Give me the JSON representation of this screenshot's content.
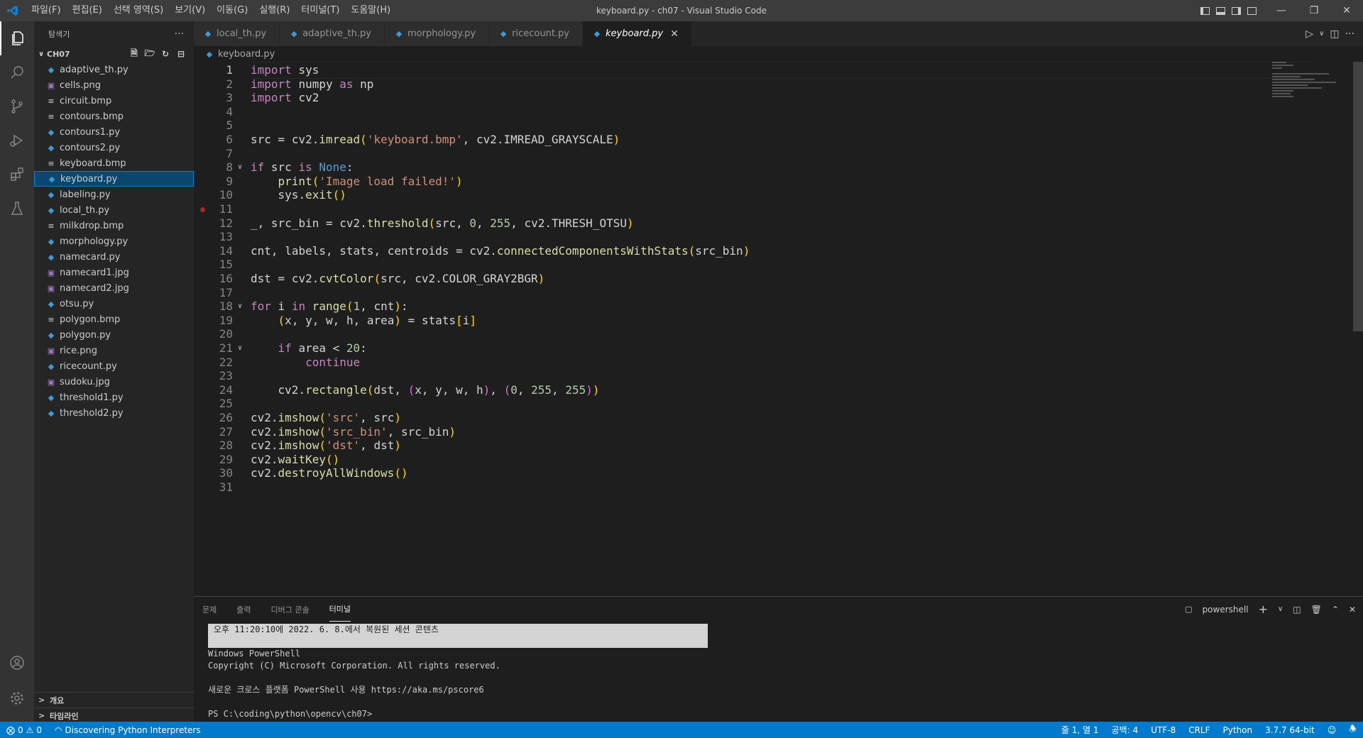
{
  "window": {
    "title": "keyboard.py - ch07 - Visual Studio Code",
    "menu": [
      "파일(F)",
      "편집(E)",
      "선택 영역(S)",
      "보기(V)",
      "이동(G)",
      "실행(R)",
      "터미널(T)",
      "도움말(H)"
    ]
  },
  "colors": {
    "accent": "#007acc",
    "selection": "#094771",
    "keyword": "#c586c0",
    "string": "#ce9178",
    "number": "#b5cea8",
    "function": "#dcdcaa"
  },
  "sidebar": {
    "header": "탐색기",
    "folder": "CH07",
    "files": [
      {
        "name": "adaptive_th.py",
        "type": "py"
      },
      {
        "name": "cells.png",
        "type": "img"
      },
      {
        "name": "circuit.bmp",
        "type": "bmp"
      },
      {
        "name": "contours.bmp",
        "type": "bmp"
      },
      {
        "name": "contours1.py",
        "type": "py"
      },
      {
        "name": "contours2.py",
        "type": "py"
      },
      {
        "name": "keyboard.bmp",
        "type": "bmp"
      },
      {
        "name": "keyboard.py",
        "type": "py",
        "selected": true
      },
      {
        "name": "labeling.py",
        "type": "py"
      },
      {
        "name": "local_th.py",
        "type": "py"
      },
      {
        "name": "milkdrop.bmp",
        "type": "bmp"
      },
      {
        "name": "morphology.py",
        "type": "py"
      },
      {
        "name": "namecard.py",
        "type": "py"
      },
      {
        "name": "namecard1.jpg",
        "type": "img"
      },
      {
        "name": "namecard2.jpg",
        "type": "img"
      },
      {
        "name": "otsu.py",
        "type": "py"
      },
      {
        "name": "polygon.bmp",
        "type": "bmp"
      },
      {
        "name": "polygon.py",
        "type": "py"
      },
      {
        "name": "rice.png",
        "type": "img"
      },
      {
        "name": "ricecount.py",
        "type": "py"
      },
      {
        "name": "sudoku.jpg",
        "type": "img"
      },
      {
        "name": "threshold1.py",
        "type": "py"
      },
      {
        "name": "threshold2.py",
        "type": "py"
      }
    ],
    "outline": "개요",
    "timeline": "타임라인"
  },
  "tabs": [
    {
      "label": "local_th.py",
      "active": false
    },
    {
      "label": "adaptive_th.py",
      "active": false
    },
    {
      "label": "morphology.py",
      "active": false
    },
    {
      "label": "ricecount.py",
      "active": false
    },
    {
      "label": "keyboard.py",
      "active": true
    }
  ],
  "breadcrumb": "keyboard.py",
  "code_lines": [
    "import sys",
    "import numpy as np",
    "import cv2",
    "",
    "",
    "src = cv2.imread('keyboard.bmp', cv2.IMREAD_GRAYSCALE)",
    "",
    "if src is None:",
    "    print('Image load failed!')",
    "    sys.exit()",
    "",
    "_, src_bin = cv2.threshold(src, 0, 255, cv2.THRESH_OTSU)",
    "",
    "cnt, labels, stats, centroids = cv2.connectedComponentsWithStats(src_bin)",
    "",
    "dst = cv2.cvtColor(src, cv2.COLOR_GRAY2BGR)",
    "",
    "for i in range(1, cnt):",
    "    (x, y, w, h, area) = stats[i]",
    "",
    "    if area < 20:",
    "        continue",
    "",
    "    cv2.rectangle(dst, (x, y, w, h), (0, 255, 255))",
    "",
    "cv2.imshow('src', src)",
    "cv2.imshow('src_bin', src_bin)",
    "cv2.imshow('dst', dst)",
    "cv2.waitKey()",
    "cv2.destroyAllWindows()",
    ""
  ],
  "panel": {
    "tabs": [
      "문제",
      "출력",
      "디버그 콘솔",
      "터미널"
    ],
    "active_tab": "터미널",
    "shell": "powershell",
    "terminal": {
      "banner": "오후 11:20:10에 2022. 6. 8.에서 복원된 세션 콘텐츠",
      "lines": [
        "Windows PowerShell",
        "Copyright (C) Microsoft Corporation. All rights reserved.",
        "",
        "새로운 크로스 플랫폼 PowerShell 사용 https://aka.ms/pscore6",
        "",
        "PS C:\\coding\\python\\opencv\\ch07>"
      ]
    }
  },
  "status": {
    "errors": "0",
    "warnings": "0",
    "task": "Discovering Python Interpreters",
    "position": "줄 1, 열 1",
    "spaces": "공백: 4",
    "encoding": "UTF-8",
    "eol": "CRLF",
    "language": "Python",
    "interpreter": "3.7.7 64-bit"
  }
}
